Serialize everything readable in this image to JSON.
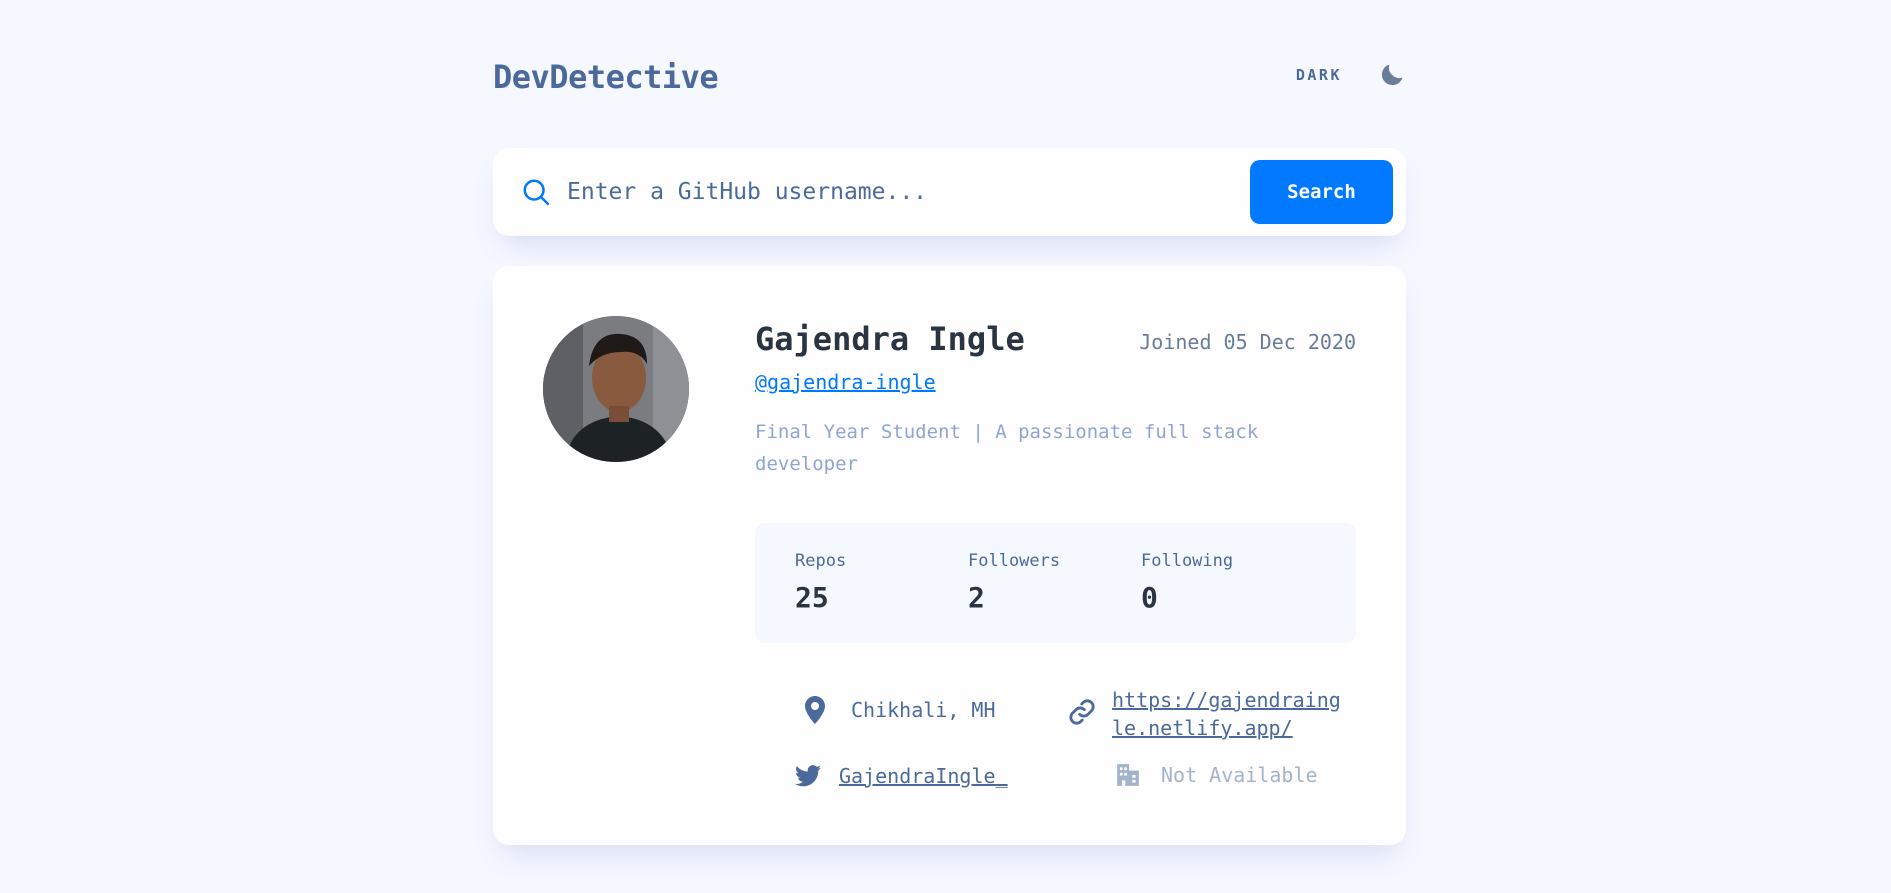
{
  "header": {
    "logo": "DevDetective",
    "mode_label": "DARK",
    "mode_icon": "moon-icon"
  },
  "search": {
    "placeholder": "Enter a GitHub username...",
    "value": "",
    "button_label": "Search"
  },
  "profile": {
    "name": "Gajendra Ingle",
    "joined": "Joined 05 Dec 2020",
    "login": "@gajendra-ingle",
    "bio": "Final Year Student | A passionate full stack developer",
    "stats": [
      {
        "label": "Repos",
        "value": "25"
      },
      {
        "label": "Followers",
        "value": "2"
      },
      {
        "label": "Following",
        "value": "0"
      }
    ],
    "links": {
      "location": "Chikhali, MH",
      "website": "https://gajendraingle.netlify.app/",
      "twitter": "GajendraIngle_",
      "company": "Not Available"
    }
  },
  "colors": {
    "background": "#f6f8ff",
    "card": "#fefefe",
    "accent": "#0079ff",
    "text_primary": "#2b3442",
    "text_secondary": "#4b6a9b"
  }
}
